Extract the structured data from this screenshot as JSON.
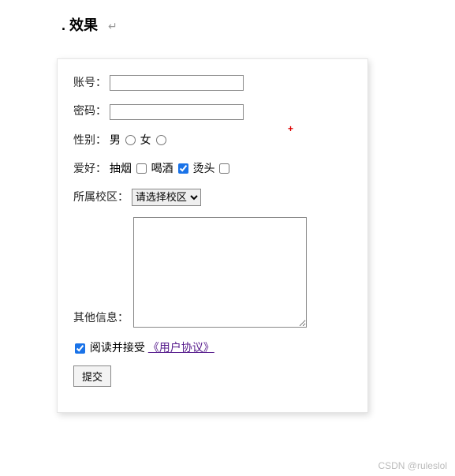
{
  "heading": ". 效果",
  "return_symbol": "↵",
  "form": {
    "account_label": "账号：",
    "password_label": "密码：",
    "gender_label": "性别：",
    "gender_male": "男",
    "gender_female": "女",
    "hobby_label": "爱好：",
    "hobby_smoke": "抽烟",
    "hobby_drink": "喝酒",
    "hobby_perm": "烫头",
    "hobby_drink_checked": true,
    "campus_label": "所属校区：",
    "campus_placeholder": "请选择校区",
    "other_label": "其他信息：",
    "agree_prefix": "阅读并接受",
    "agreement_link": "《用户协议》",
    "agree_checked": true,
    "submit_label": "提交"
  },
  "watermark": "CSDN @ruleslol"
}
